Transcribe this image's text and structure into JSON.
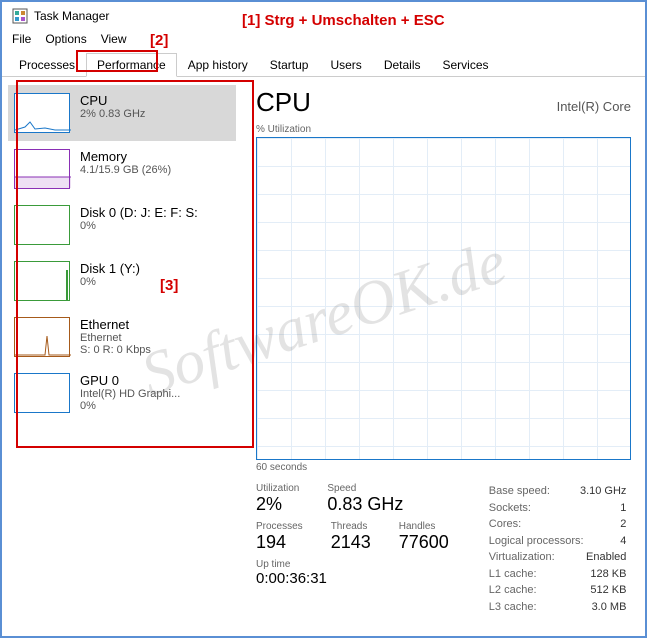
{
  "window": {
    "title": "Task Manager"
  },
  "menu": {
    "file": "File",
    "options": "Options",
    "view": "View"
  },
  "tabs": {
    "processes": "Processes",
    "performance": "Performance",
    "apphistory": "App history",
    "startup": "Startup",
    "users": "Users",
    "details": "Details",
    "services": "Services"
  },
  "sidebar": [
    {
      "title": "CPU",
      "sub": "2%  0.83 GHz",
      "color": "#1a77c9"
    },
    {
      "title": "Memory",
      "sub": "4.1/15.9 GB (26%)",
      "color": "#8a2fb5"
    },
    {
      "title": "Disk 0 (D: J: E: F: S:",
      "sub": "0%",
      "color": "#3a9b3a"
    },
    {
      "title": "Disk 1 (Y:)",
      "sub": "0%",
      "color": "#3a9b3a"
    },
    {
      "title": "Ethernet",
      "sub": "Ethernet",
      "sub2": "S: 0  R: 0 Kbps",
      "color": "#a65a1a"
    },
    {
      "title": "GPU 0",
      "sub": "Intel(R) HD Graphi...",
      "sub2": "0%",
      "color": "#1a77c9"
    }
  ],
  "detail": {
    "title": "CPU",
    "device": "Intel(R) Core",
    "chart_top": "% Utilization",
    "chart_bottom": "60 seconds",
    "utilization_label": "Utilization",
    "utilization": "2%",
    "speed_label": "Speed",
    "speed": "0.83 GHz",
    "processes_label": "Processes",
    "processes": "194",
    "threads_label": "Threads",
    "threads": "2143",
    "handles_label": "Handles",
    "handles": "77600",
    "uptime_label": "Up time",
    "uptime": "0:00:36:31",
    "right": [
      {
        "label": "Base speed:",
        "value": "3.10 GHz"
      },
      {
        "label": "Sockets:",
        "value": "1"
      },
      {
        "label": "Cores:",
        "value": "2"
      },
      {
        "label": "Logical processors:",
        "value": "4"
      },
      {
        "label": "Virtualization:",
        "value": "Enabled"
      },
      {
        "label": "L1 cache:",
        "value": "128 KB"
      },
      {
        "label": "L2 cache:",
        "value": "512 KB"
      },
      {
        "label": "L3 cache:",
        "value": "3.0 MB"
      }
    ]
  },
  "annotations": {
    "a1": "[1]   Strg + Umschalten + ESC",
    "a2": "[2]",
    "a3": "[3]"
  },
  "watermark": "SoftwareOK.de",
  "chart_data": {
    "type": "area",
    "title": "% Utilization",
    "xlabel": "60 seconds",
    "ylim": [
      0,
      100
    ],
    "series": [
      {
        "name": "CPU",
        "values": [
          2
        ]
      }
    ]
  }
}
